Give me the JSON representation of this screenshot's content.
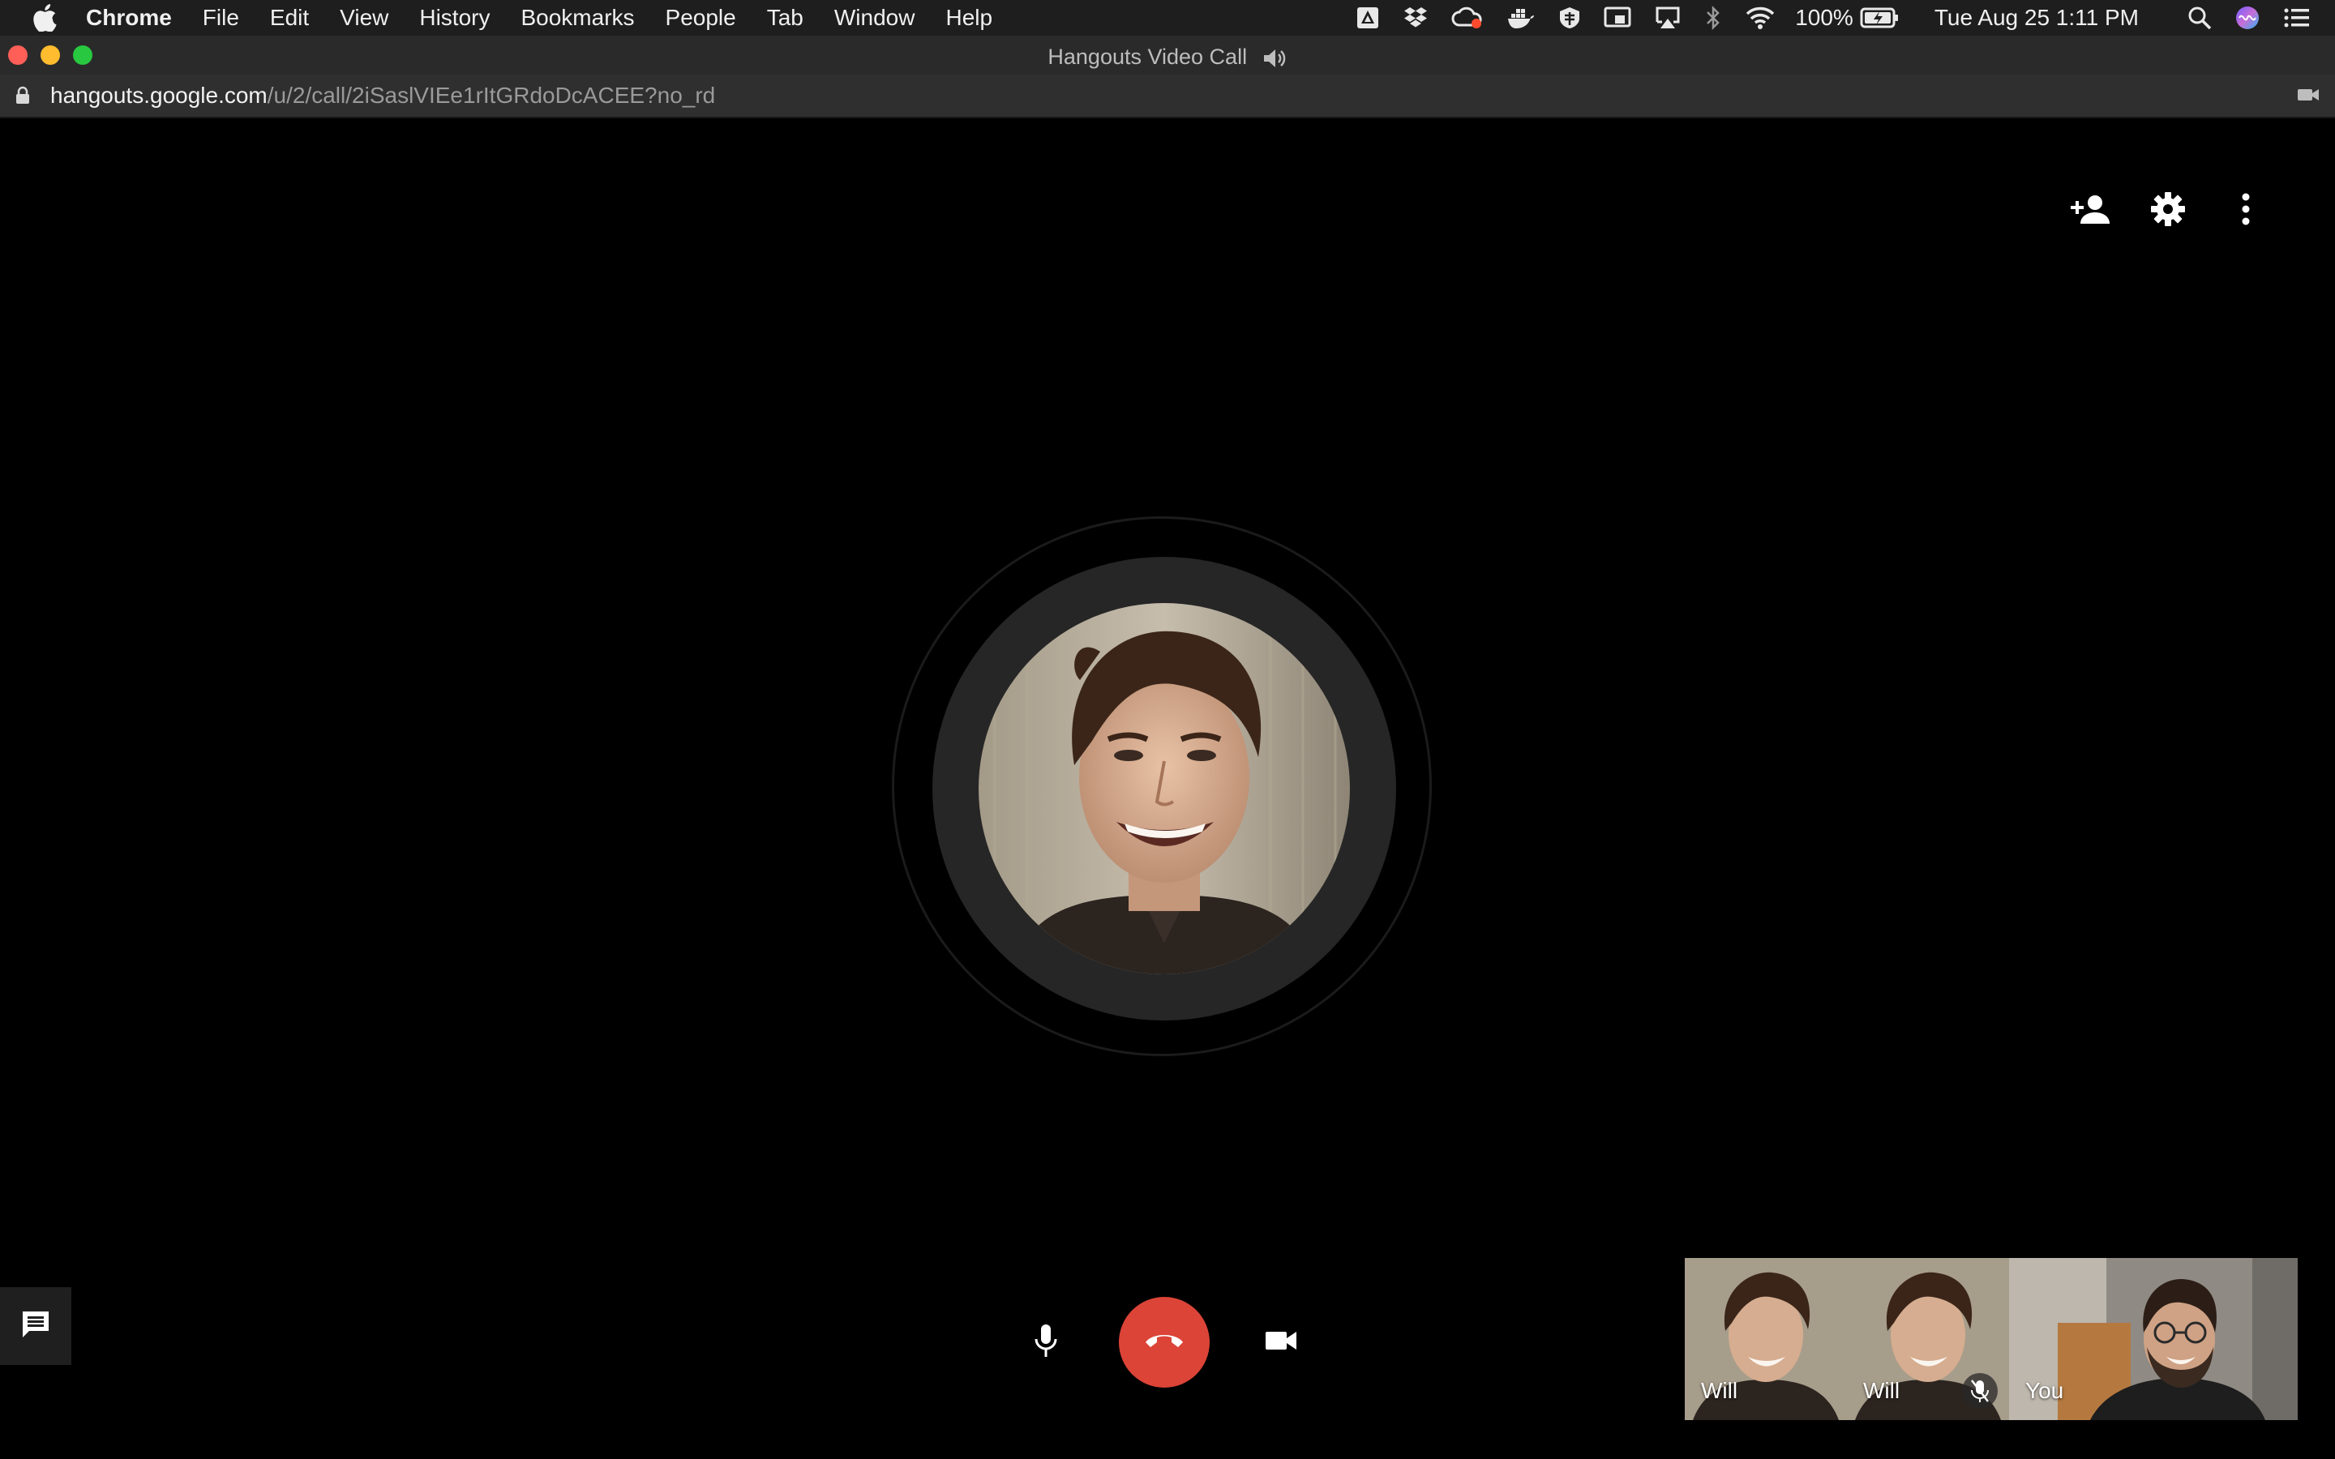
{
  "menubar": {
    "app_name": "Chrome",
    "items": [
      "File",
      "Edit",
      "View",
      "History",
      "Bookmarks",
      "People",
      "Tab",
      "Window",
      "Help"
    ],
    "battery_text": "100%",
    "datetime": "Tue Aug 25  1:11 PM",
    "tray_icons": [
      "drive-icon",
      "dropbox-icon",
      "creative-cloud-icon",
      "docker-icon",
      "app-icon",
      "screen-mirror-icon",
      "airplay-icon",
      "bluetooth-icon",
      "wifi-icon",
      "battery-icon",
      "search-icon",
      "siri-icon",
      "notification-center-icon"
    ]
  },
  "window": {
    "title": "Hangouts Video Call",
    "title_icon": "speaker-icon",
    "traffic_colors": {
      "close": "#ff5f57",
      "minimize": "#febc2e",
      "zoom": "#28c840"
    }
  },
  "address": {
    "domain": "hangouts.google.com",
    "path": "/u/2/call/2iSaslVIEe1rItGRdoDcACEE?no_rd"
  },
  "call": {
    "top_actions": [
      "add-person-icon",
      "settings-icon",
      "more-vert-icon"
    ],
    "hangup_color": "#db4437",
    "participants": [
      {
        "name": "Will",
        "muted": false
      },
      {
        "name": "Will",
        "muted": true
      },
      {
        "name": "You",
        "muted": false
      }
    ]
  }
}
